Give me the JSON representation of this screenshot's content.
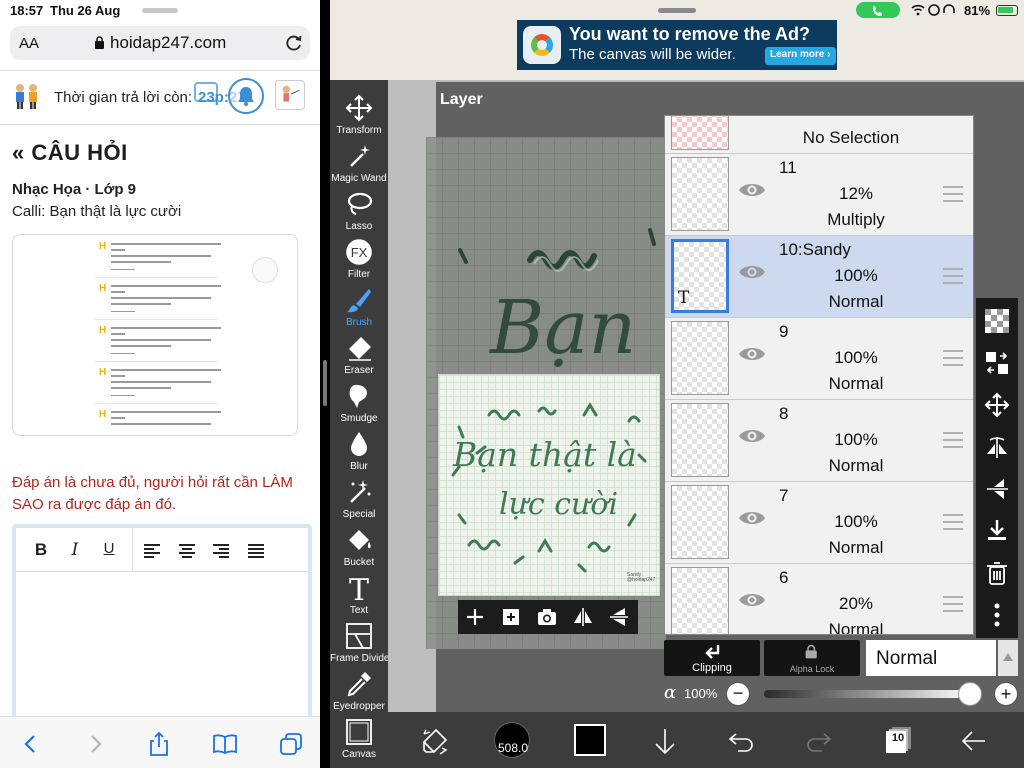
{
  "safari": {
    "status": {
      "time": "18:57",
      "date": "Thu 26 Aug"
    },
    "address_bar": {
      "text_size_label": "AA",
      "url": "hoidap247.com"
    },
    "timer": {
      "label": "Thời gian trả lời còn:",
      "value": "23p:27"
    },
    "section_title": "CÂU HỎI",
    "subject": "Nhạc Họa · Lớp 9",
    "question": "Calli: Bạn thật là lực cười",
    "answer_note": "Đáp án là chưa đủ, người hỏi rất cần LÀM SAO ra được đáp án đó.",
    "editor_toolbar": {
      "bold": "B",
      "italic": "I",
      "underline": "U"
    },
    "bottom_icons": [
      "back-icon",
      "forward-icon",
      "share-icon",
      "bookmarks-icon",
      "tabs-icon"
    ]
  },
  "ibis": {
    "status": {
      "battery_percent": "81%"
    },
    "ad": {
      "headline": "You want to remove the Ad?",
      "subline": "The canvas will be wider.",
      "cta": "Learn more ›"
    },
    "tools": [
      {
        "label": "Transform",
        "icon": "transform-icon"
      },
      {
        "label": "Magic Wand",
        "icon": "magic-wand-icon"
      },
      {
        "label": "Lasso",
        "icon": "lasso-icon"
      },
      {
        "label": "Filter",
        "icon": "filter-icon"
      },
      {
        "label": "Brush",
        "icon": "brush-icon",
        "active": true
      },
      {
        "label": "Eraser",
        "icon": "eraser-icon"
      },
      {
        "label": "Smudge",
        "icon": "smudge-icon"
      },
      {
        "label": "Blur",
        "icon": "blur-icon"
      },
      {
        "label": "Special",
        "icon": "special-icon"
      },
      {
        "label": "Bucket",
        "icon": "bucket-icon"
      },
      {
        "label": "Text",
        "icon": "text-icon"
      },
      {
        "label": "Frame Divider",
        "icon": "frame-divider-icon"
      },
      {
        "label": "Eyedropper",
        "icon": "eyedropper-icon"
      },
      {
        "label": "Canvas",
        "icon": "canvas-icon"
      }
    ],
    "layer_window": {
      "title": "Layer",
      "no_selection": "No Selection",
      "layers": [
        {
          "name": "11",
          "opacity": "12%",
          "blend": "Multiply",
          "selected": false
        },
        {
          "name": "10:Sandy",
          "opacity": "100%",
          "blend": "Normal",
          "selected": true,
          "text_layer": "T"
        },
        {
          "name": "9",
          "opacity": "100%",
          "blend": "Normal",
          "selected": false
        },
        {
          "name": "8",
          "opacity": "100%",
          "blend": "Normal",
          "selected": false
        },
        {
          "name": "7",
          "opacity": "100%",
          "blend": "Normal",
          "selected": false
        },
        {
          "name": "6",
          "opacity": "20%",
          "blend": "Normal",
          "selected": false
        }
      ],
      "clipping_label": "Clipping",
      "alpha_lock_label": "Alpha Lock",
      "blend_mode": "Normal",
      "alpha_symbol": "α",
      "alpha_value": "100%",
      "alpha_level": 1.0
    },
    "artwork": {
      "line1": "Bạn thật là",
      "line2": "lực cười",
      "signature": "Sandy @hoidap247"
    },
    "bottom_toolbar": {
      "brush_size": "508.0",
      "layer_count": "10",
      "color": "#000000"
    }
  }
}
